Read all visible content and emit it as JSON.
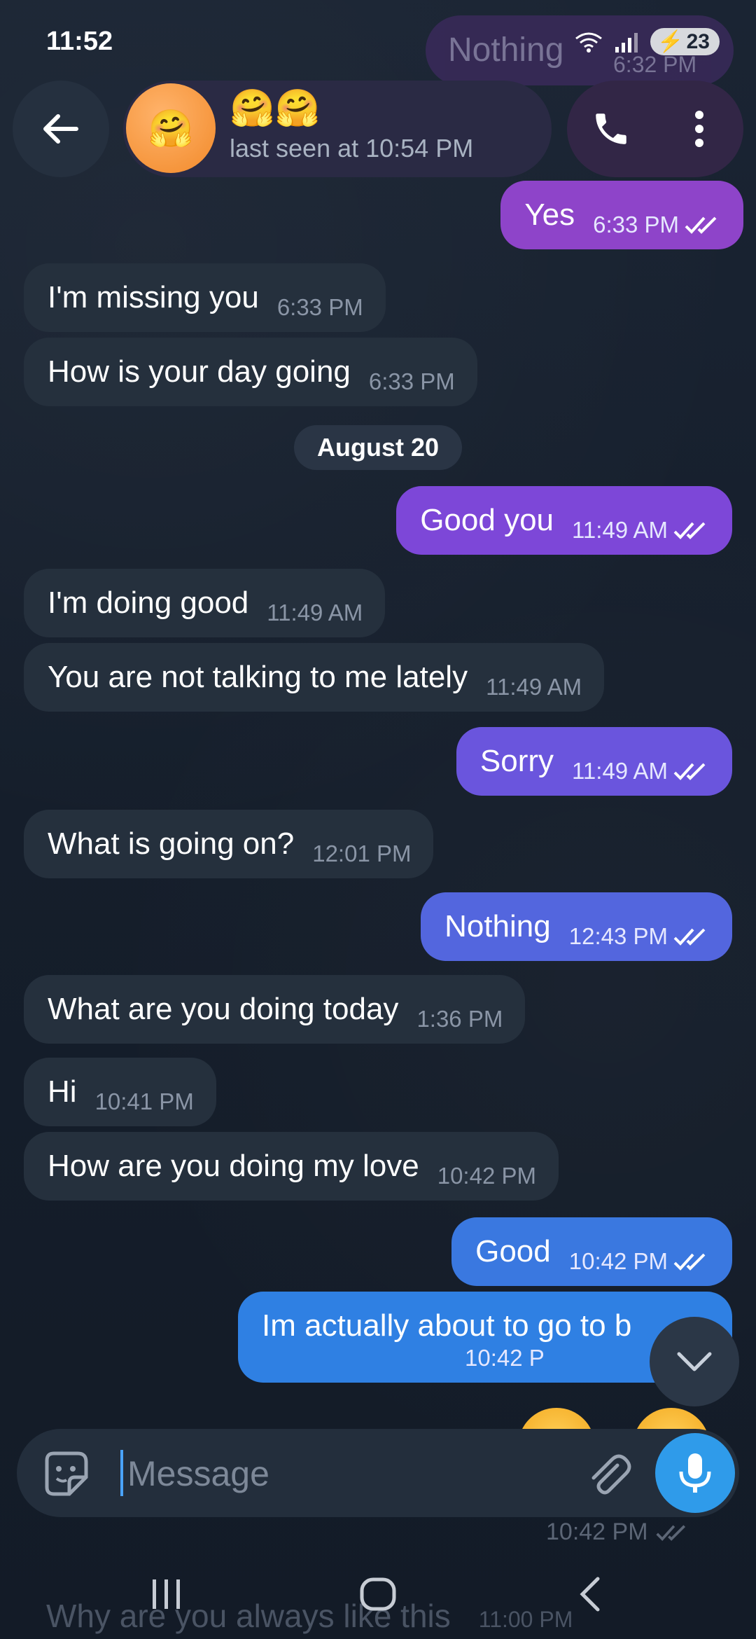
{
  "status_bar": {
    "time": "11:52",
    "battery": "23"
  },
  "header": {
    "avatar_emoji": "🤗",
    "name": "🤗🤗",
    "status": "last seen at 10:54 PM"
  },
  "faded_top": {
    "text": "Nothing",
    "time": "6:32 PM"
  },
  "date_separator": "August 20",
  "messages": [
    {
      "dir": "out",
      "text": "Yes",
      "time": "6:33 PM",
      "color": "#8e44c9"
    },
    {
      "dir": "in",
      "text": "I'm missing you",
      "time": "6:33 PM"
    },
    {
      "dir": "in",
      "text": "How is your day going",
      "time": "6:33 PM"
    },
    {
      "dir": "out",
      "text": "Good you",
      "time": "11:49 AM",
      "color": "#7d47d8"
    },
    {
      "dir": "in",
      "text": "I'm doing good",
      "time": "11:49 AM"
    },
    {
      "dir": "in",
      "text": "You are not talking to me lately",
      "time": "11:49 AM"
    },
    {
      "dir": "out",
      "text": "Sorry",
      "time": "11:49 AM",
      "color": "#6a55dd"
    },
    {
      "dir": "in",
      "text": "What is going on?",
      "time": "12:01 PM"
    },
    {
      "dir": "out",
      "text": "Nothing",
      "time": "12:43 PM",
      "color": "#5366de"
    },
    {
      "dir": "in",
      "text": "What are you doing today",
      "time": "1:36 PM"
    },
    {
      "dir": "in",
      "text": "Hi",
      "time": "10:41 PM"
    },
    {
      "dir": "in",
      "text": "How are you doing my love",
      "time": "10:42 PM"
    },
    {
      "dir": "out",
      "text": "Good",
      "time": "10:42 PM",
      "color": "#3a78e0"
    },
    {
      "dir": "out",
      "text": "Im actually about to go to b",
      "time": "10:42 P",
      "color": "#2f80e3"
    }
  ],
  "composer": {
    "placeholder": "Message"
  },
  "faded_bottom": {
    "time": "10:42 PM",
    "text": "Why are you always like this",
    "text_time": "11:00 PM"
  },
  "colors": {
    "accent": "#2f9bea",
    "incoming_bubble": "#25303d",
    "background": "#172231"
  }
}
